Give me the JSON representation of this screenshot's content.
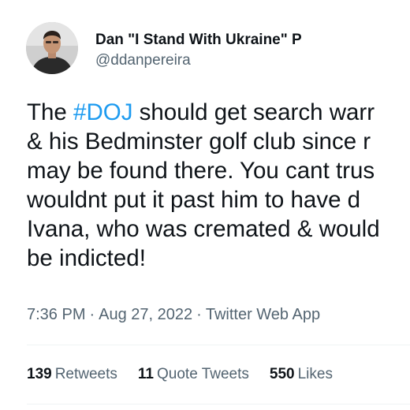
{
  "author": {
    "display_name": "Dan \"I Stand With Ukraine\" P",
    "handle": "@ddanpereira"
  },
  "tweet": {
    "line1_prefix": "The ",
    "hashtag": "#DOJ",
    "line1_suffix": " should get search warr",
    "line2": "& his Bedminster golf club since r",
    "line3": "may be found there. You cant trus",
    "line4": "wouldnt put it past him to have d",
    "line5": "Ivana, who was cremated & would",
    "line6": "be indicted!"
  },
  "meta": {
    "time": "7:36 PM",
    "separator": "·",
    "date": "Aug 27, 2022",
    "source": "Twitter Web App"
  },
  "stats": {
    "retweets_count": "139",
    "retweets_label": "Retweets",
    "quotes_count": "11",
    "quotes_label": "Quote Tweets",
    "likes_count": "550",
    "likes_label": "Likes"
  },
  "colors": {
    "hashtag": "#1d9bf0",
    "secondary_text": "#536471",
    "primary_text": "#0f1419",
    "divider": "#eff3f4"
  }
}
